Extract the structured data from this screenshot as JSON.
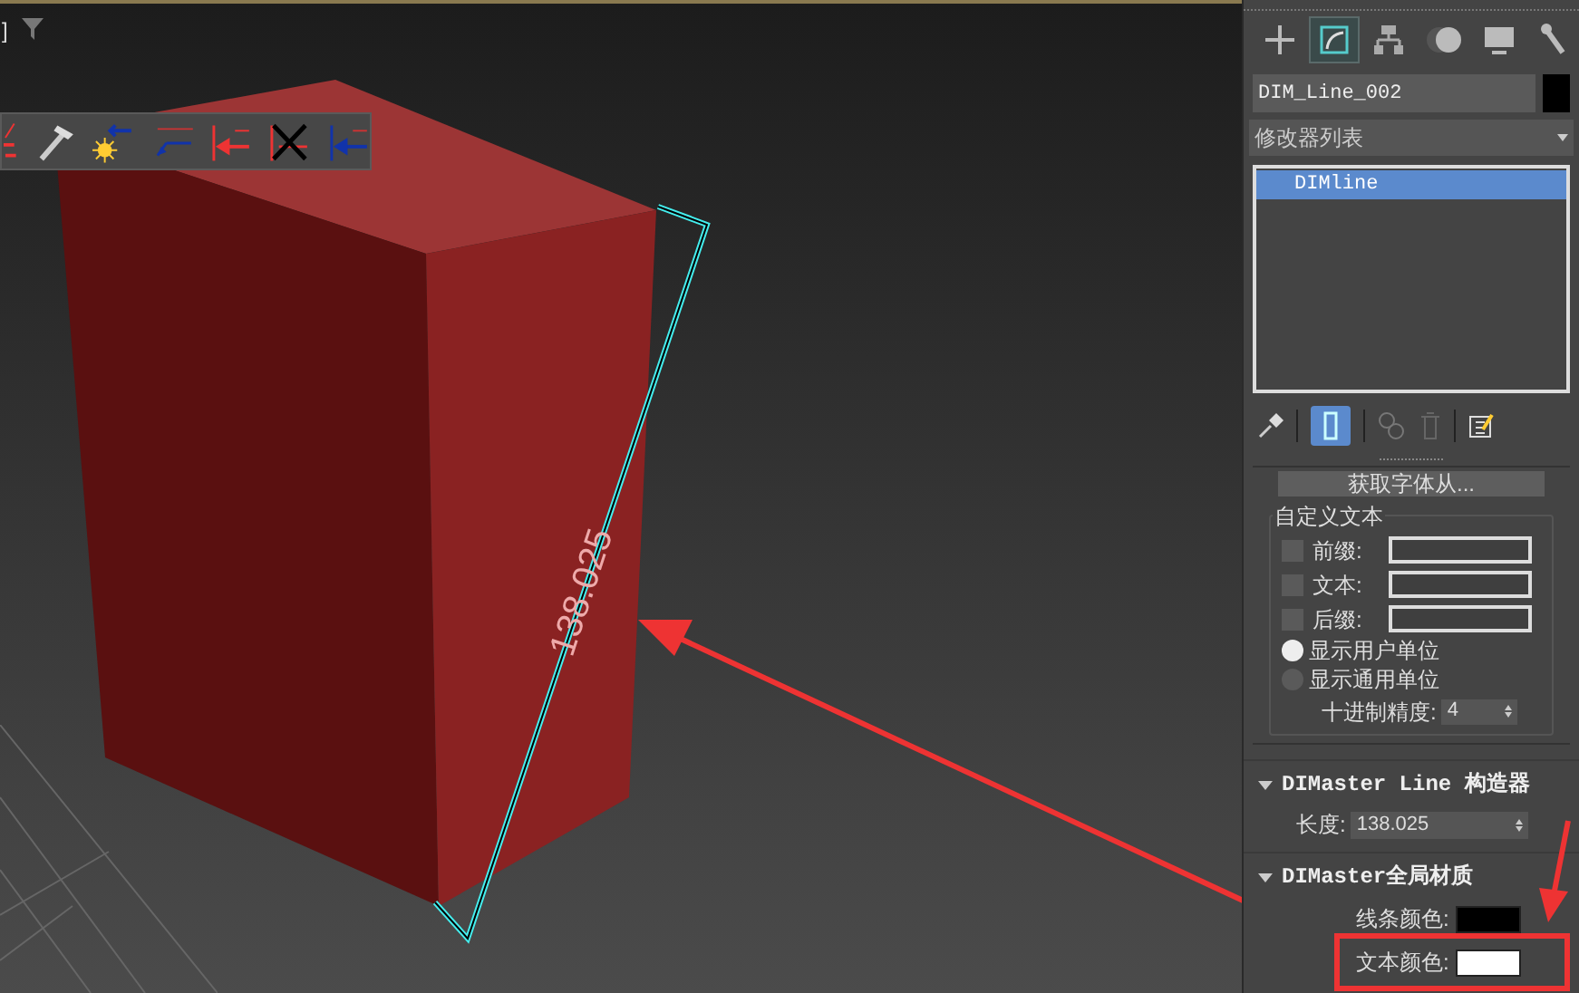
{
  "viewport": {
    "label": "]",
    "dimension_text": "138.025"
  },
  "command_tabs": [
    {
      "kind": "create",
      "selected": false
    },
    {
      "kind": "modify",
      "selected": true
    },
    {
      "kind": "hierarchy",
      "selected": false
    },
    {
      "kind": "motion",
      "selected": false
    },
    {
      "kind": "display",
      "selected": false
    },
    {
      "kind": "utilities",
      "selected": false
    }
  ],
  "object_name": "DIM_Line_002",
  "modifier_list": "修改器列表",
  "modifier_stack": [
    {
      "label": "DIMline",
      "selected": true
    }
  ],
  "show_end_result": true,
  "text_rollout": {
    "button": "获取字体从...",
    "group": "自定义文本",
    "fields": [
      {
        "label": "前缀:",
        "checked": false
      },
      {
        "label": "文本:",
        "checked": false
      },
      {
        "label": "后缀:",
        "checked": false
      }
    ],
    "units": [
      {
        "label": "显示用户单位",
        "selected": true
      },
      {
        "label": "显示通用单位",
        "selected": false
      }
    ],
    "precision_label": "十进制精度:",
    "precision": "4"
  },
  "line_rollout": {
    "title": "DIMaster Line 构造器",
    "length_label": "长度:",
    "length": "138.025"
  },
  "material_rollout": {
    "title": "DIMaster全局材质",
    "colors": [
      {
        "label": "线条颜色:",
        "color": "#000000"
      },
      {
        "label": "文本颜色:",
        "color": "#ffffff"
      }
    ]
  }
}
